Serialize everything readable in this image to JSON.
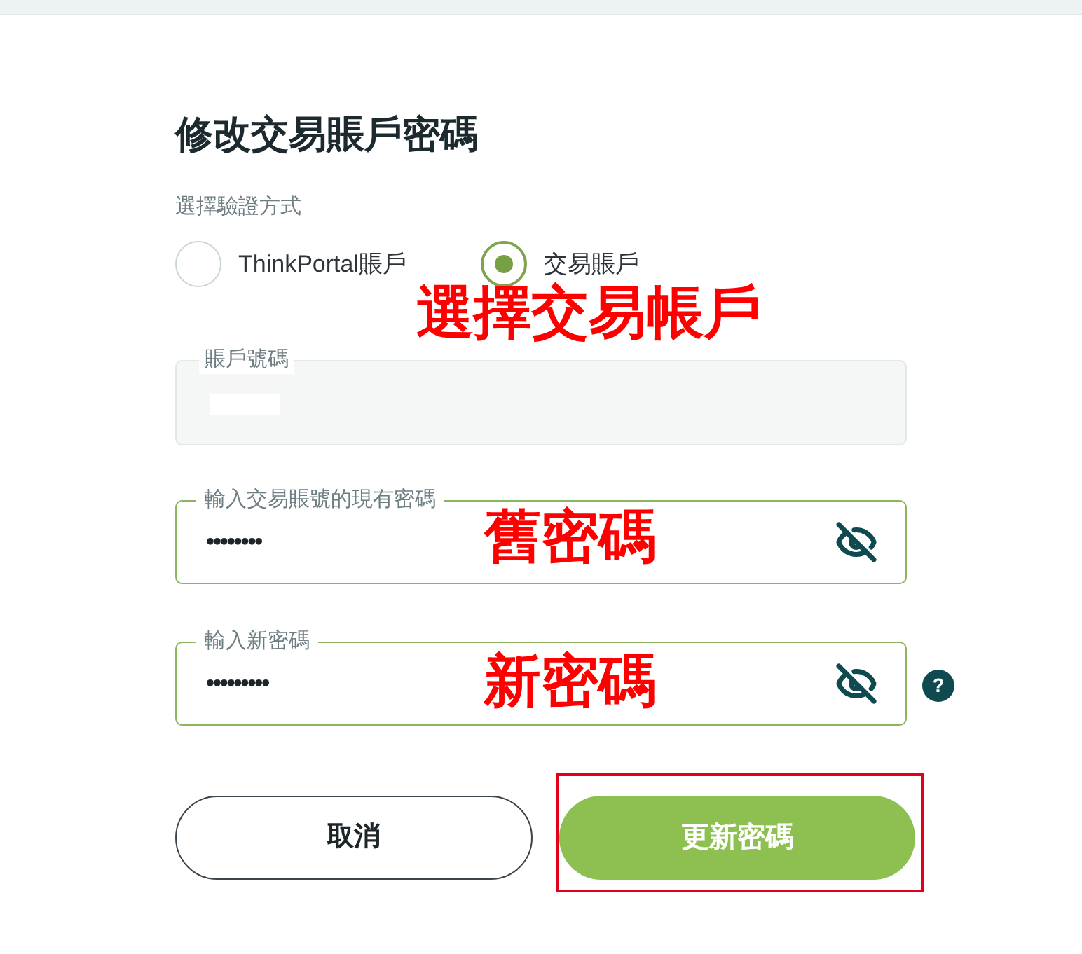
{
  "form": {
    "title": "修改交易賬戶密碼",
    "method_label": "選擇驗證方式",
    "methods": [
      {
        "label": "ThinkPortal賬戶",
        "selected": false
      },
      {
        "label": "交易賬戶",
        "selected": true
      }
    ],
    "fields": [
      {
        "kind": "readonly",
        "label": "賬戶號碼",
        "value_redacted": true
      },
      {
        "kind": "password",
        "label": "輸入交易賬號的現有密碼",
        "value": "••••••••"
      },
      {
        "kind": "password",
        "label": "輸入新密碼",
        "value": "•••••••••",
        "help_mark": "?"
      }
    ],
    "buttons": [
      {
        "kind": "secondary",
        "label": "取消",
        "highlighted": false
      },
      {
        "kind": "primary",
        "label": "更新密碼",
        "highlighted": true
      }
    ]
  },
  "annotations": [
    {
      "text": "選擇交易帳戶"
    },
    {
      "text": "舊密碼"
    },
    {
      "text": "新密碼"
    }
  ]
}
